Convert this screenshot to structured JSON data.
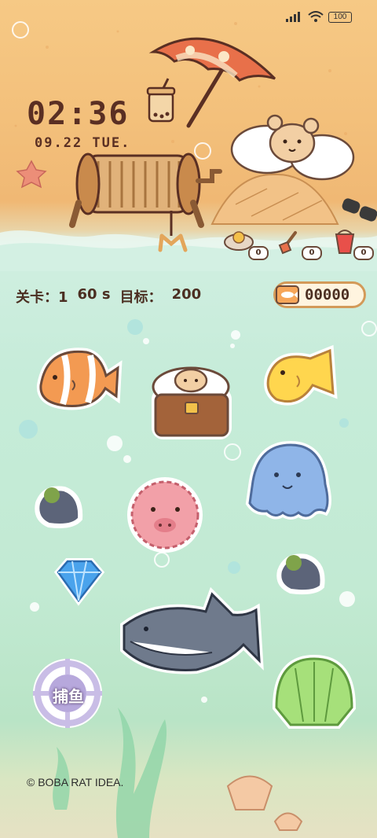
{
  "status_bar": {
    "battery": "100"
  },
  "clock": {
    "time": "02:36",
    "date": "09.22  TUE."
  },
  "hud": {
    "level_label": "关卡：1",
    "timer": "60 s",
    "target_label": "目标：",
    "target_value": "200",
    "score": "00000"
  },
  "inventory": [
    {
      "name": "coin-bowl",
      "count": "0"
    },
    {
      "name": "shovel",
      "count": "0"
    },
    {
      "name": "bucket",
      "count": "0"
    }
  ],
  "catch_button": {
    "label": "捕鱼"
  },
  "footer": {
    "copyright": "© BOBA RAT IDEA."
  },
  "colors": {
    "sand": "#f3c07b",
    "sea": "#c6ecd9",
    "outline": "#5a2f23",
    "accent": "#e8704a"
  }
}
